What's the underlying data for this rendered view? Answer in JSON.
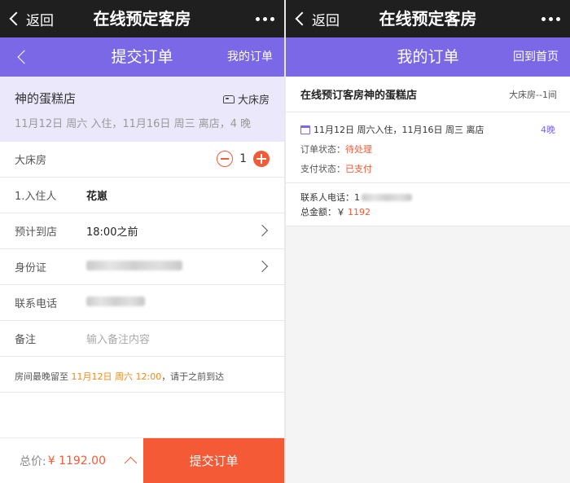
{
  "left": {
    "wechat": {
      "back_label": "返回",
      "title": "在线预定客房"
    },
    "nav": {
      "title": "提交订单",
      "right_link": "我的订单"
    },
    "hotel": {
      "name": "神的蛋糕店",
      "room_type": "大床房",
      "dates": "11月12日 周六 入住，11月16日 周三 离店，4 晚"
    },
    "room_row": {
      "label": "大床房",
      "count": "1"
    },
    "guest_row": {
      "label": "1.入住人",
      "value": "花崽"
    },
    "arrival_row": {
      "label": "预计到店",
      "value": "18:00之前"
    },
    "id_row": {
      "label": "身份证"
    },
    "phone_row": {
      "label": "联系电话"
    },
    "remark_row": {
      "label": "备注",
      "placeholder": "输入备注内容"
    },
    "notice": {
      "prefix": "房间最晚留至 ",
      "highlight": "11月12日 周六 12:00",
      "suffix": "，请于之前到达"
    },
    "bottom": {
      "total_label": "总价:",
      "total_value": "¥ 1192.00",
      "submit_label": "提交订单"
    }
  },
  "right": {
    "wechat": {
      "back_label": "返回",
      "title": "在线预定客房"
    },
    "nav": {
      "title": "我的订单",
      "right_link": "回到首页"
    },
    "order": {
      "title": "在线预订客房神的蛋糕店",
      "room": "大床房--1间",
      "dates": "11月12日 周六入住，11月16日 周三 离店",
      "nights": "4晚",
      "status_label": "订单状态：",
      "status_value": "待处理",
      "pay_label": "支付状态：",
      "pay_value": "已支付",
      "contact_label": "联系人电话：",
      "contact_prefix": "1",
      "total_label": "总金额：",
      "total_currency": "￥",
      "total_value": "1192"
    }
  },
  "colors": {
    "primary_purple": "#7b68e6",
    "accent_orange": "#f45a36",
    "highlight_orange": "#f08a1c"
  }
}
